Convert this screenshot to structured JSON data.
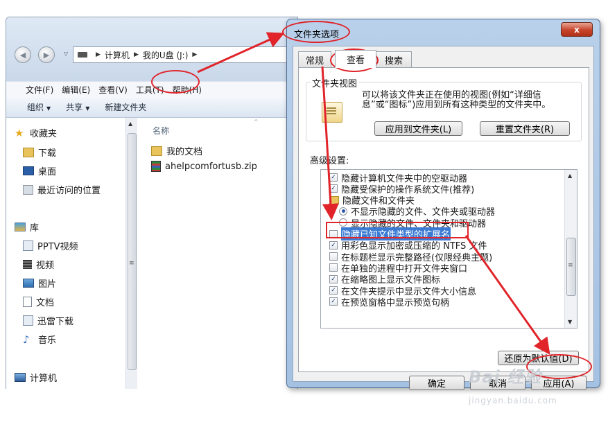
{
  "explorer": {
    "address": [
      "计算机",
      "我的U盘 (J:)"
    ],
    "menu": [
      "文件(F)",
      "编辑(E)",
      "查看(V)",
      "工具(T)",
      "帮助(H)"
    ],
    "toolbar": {
      "organize": "组织",
      "share": "共享",
      "new_folder": "新建文件夹"
    },
    "nav": {
      "favorites": "收藏夹",
      "downloads": "下载",
      "desktop": "桌面",
      "recent": "最近访问的位置",
      "libraries": "库",
      "pptv": "PPTV视频",
      "videos": "视频",
      "pictures": "图片",
      "documents": "文档",
      "xunlei": "迅雷下载",
      "music": "音乐",
      "computer": "计算机"
    },
    "column_name": "名称",
    "files": [
      "我的文档",
      "ahelpcomfortusb.zip"
    ]
  },
  "dialog": {
    "title": "文件夹选项",
    "close": "x",
    "tabs": [
      "常规",
      "查看",
      "搜索"
    ],
    "folder_view": {
      "label": "文件夹视图",
      "description": "可以将该文件夹正在使用的视图(例如“详细信息”或“图标”)应用到所有这种类型的文件夹中。",
      "apply_btn": "应用到文件夹(L)",
      "reset_btn": "重置文件夹(R)"
    },
    "advanced_label": "高级设置:",
    "settings": [
      {
        "kind": "check",
        "checked": true,
        "text": "隐藏计算机文件夹中的空驱动器"
      },
      {
        "kind": "check",
        "checked": true,
        "text": "隐藏受保护的操作系统文件(推荐)"
      },
      {
        "kind": "folder",
        "text": "隐藏文件和文件夹"
      },
      {
        "kind": "radio",
        "checked": true,
        "text": "不显示隐藏的文件、文件夹或驱动器"
      },
      {
        "kind": "radio",
        "checked": false,
        "text": "显示隐藏的文件、文件夹和驱动器"
      },
      {
        "kind": "check",
        "checked": false,
        "text": "隐藏已知文件类型的扩展名",
        "highlight": true
      },
      {
        "kind": "check",
        "checked": true,
        "text": "用彩色显示加密或压缩的 NTFS 文件"
      },
      {
        "kind": "check",
        "checked": false,
        "text": "在标题栏显示完整路径(仅限经典主题)"
      },
      {
        "kind": "check",
        "checked": false,
        "text": "在单独的进程中打开文件夹窗口"
      },
      {
        "kind": "check",
        "checked": true,
        "text": "在缩略图上显示文件图标"
      },
      {
        "kind": "check",
        "checked": true,
        "text": "在文件夹提示中显示文件大小信息"
      },
      {
        "kind": "check",
        "checked": true,
        "text": "在预览窗格中显示预览句柄"
      }
    ],
    "restore_btn": "还原为默认值(D)",
    "ok_btn": "确定",
    "cancel_btn": "取消",
    "apply_btn": "应用(A)"
  },
  "watermark": {
    "logo": "Bai 经验",
    "site": "jingyan.baidu.com"
  },
  "colors": {
    "annotation_red": "#e0242a",
    "selection_blue": "#3b7bd4",
    "dialog_frame": "#a5c1e2"
  }
}
